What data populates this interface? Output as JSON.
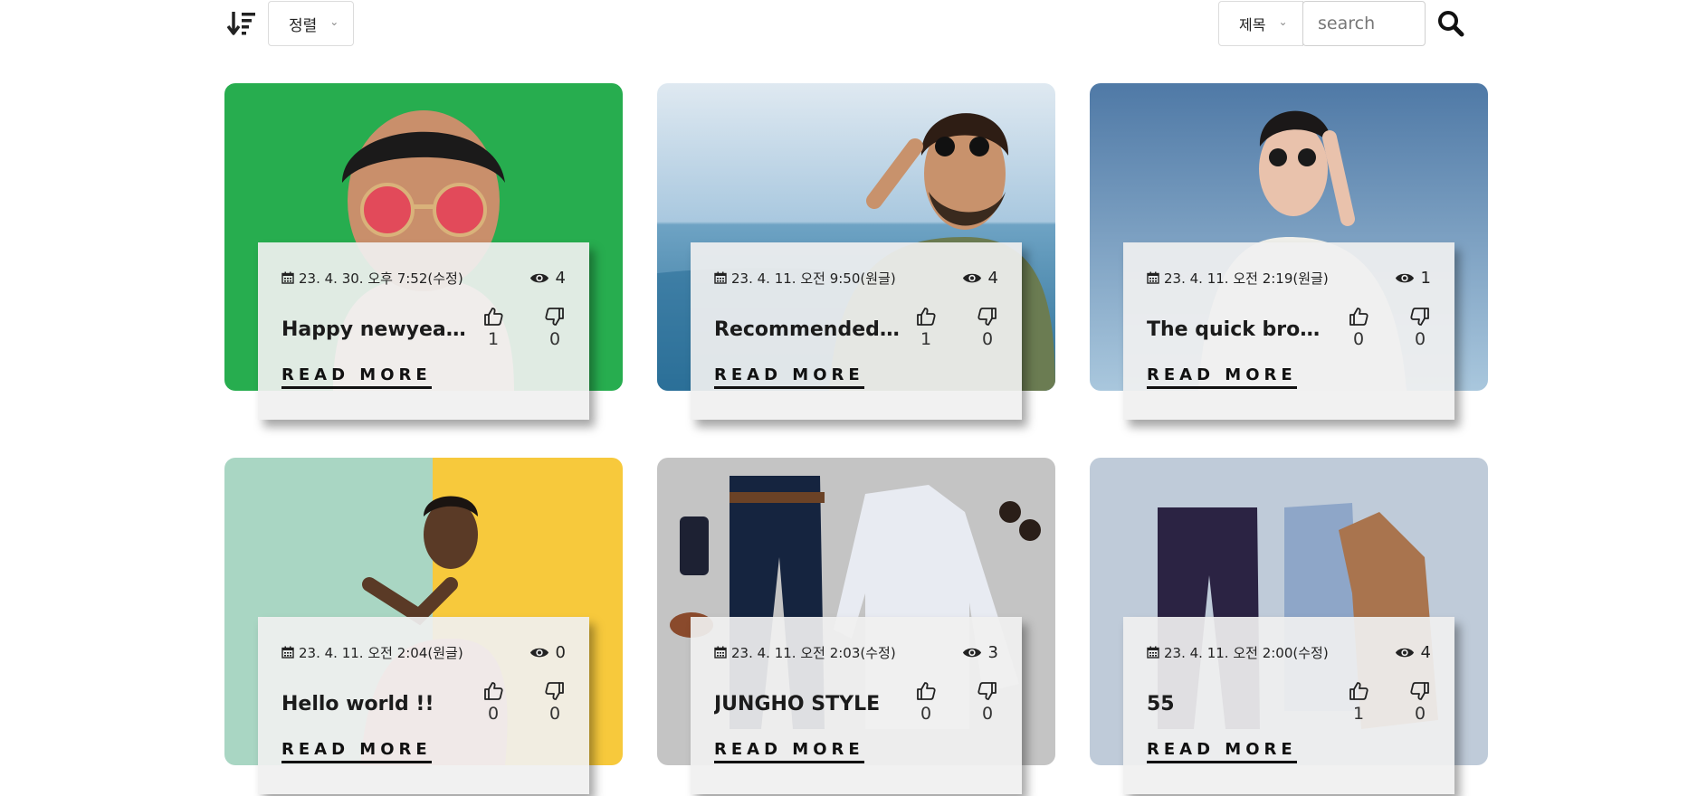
{
  "toolbar": {
    "sort_label": "정렬",
    "search_field_label": "제목",
    "search_placeholder": "search"
  },
  "posts": [
    {
      "date": "23. 4. 30. 오후 7:52(수정)",
      "views": "4",
      "title": "Happy newyears !!!",
      "likes": "1",
      "dislikes": "0",
      "read_more": "READ MORE",
      "image": "man-red-glasses-green-wall"
    },
    {
      "date": "23. 4. 11. 오전 9:50(원글)",
      "views": "4",
      "title": "Recommended Sty...",
      "likes": "1",
      "dislikes": "0",
      "read_more": "READ MORE",
      "image": "man-sunglasses-lake"
    },
    {
      "date": "23. 4. 11. 오전 2:19(원글)",
      "views": "1",
      "title": "The quick brown...",
      "likes": "0",
      "dislikes": "0",
      "read_more": "READ MORE",
      "image": "woman-sunglasses-sky"
    },
    {
      "date": "23. 4. 11. 오전 2:04(원글)",
      "views": "0",
      "title": "Hello world !!",
      "likes": "0",
      "dislikes": "0",
      "read_more": "READ MORE",
      "image": "man-smiling-yellow-wall"
    },
    {
      "date": "23. 4. 11. 오전 2:03(수정)",
      "views": "3",
      "title": "JUNGHO STYLE",
      "likes": "0",
      "dislikes": "0",
      "read_more": "READ MORE",
      "image": "flatlay-shirt-pants"
    },
    {
      "date": "23. 4. 11. 오전 2:00(수정)",
      "views": "4",
      "title": "55",
      "likes": "1",
      "dislikes": "0",
      "read_more": "READ MORE",
      "image": "flatlay-blazer-corduroy"
    }
  ]
}
